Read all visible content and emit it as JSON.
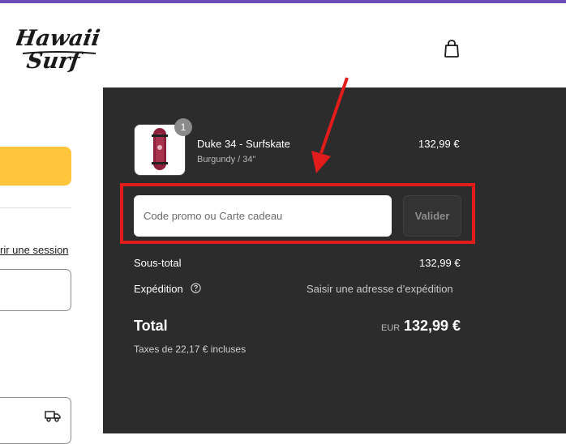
{
  "colors": {
    "accent_top": "#6e4cb7",
    "pay_button": "#ffc53d",
    "summary_bg": "#2c2c2c",
    "annotation": "#e21b1b"
  },
  "header": {
    "logo_text": "Hawaii Surf",
    "cart_icon": "shopping-bag-icon"
  },
  "left_panel": {
    "session_link": "rir une session",
    "shipping_icon": "truck-icon"
  },
  "order": {
    "item": {
      "quantity": "1",
      "name": "Duke 34 - Surfskate",
      "variant": "Burgundy / 34\"",
      "price": "132,99 €"
    },
    "promo": {
      "placeholder": "Code promo ou Carte cadeau",
      "value": "",
      "button_label": "Valider"
    },
    "subtotal": {
      "label": "Sous-total",
      "value": "132,99 €"
    },
    "shipping": {
      "label": "Expédition",
      "value": "Saisir une adresse d’expédition",
      "info_icon": "help-circle-icon"
    },
    "total": {
      "label": "Total",
      "currency": "EUR",
      "value": "132,99 €",
      "tax_note": "Taxes de 22,17 € incluses"
    }
  }
}
